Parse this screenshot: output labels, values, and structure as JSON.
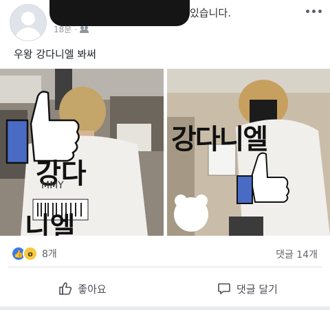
{
  "post": {
    "header_suffix": "있습니다.",
    "timestamp": "18분 ·",
    "caption": "우왕 강다니엘 봐써"
  },
  "photos": {
    "left": {
      "drawn_text_1": "강다",
      "drawn_text_2": "니엘",
      "shirt_text": "MMY"
    },
    "right": {
      "drawn_text": "강다니엘"
    }
  },
  "reactions": {
    "count": "8개",
    "comments": "댓글 14개"
  },
  "actions": {
    "like_label": "좋아요",
    "comment_label": "댓글 달기"
  },
  "colors": {
    "like_blue": "#3b7ae8",
    "wow_yellow": "#f7c940"
  },
  "icons": [
    "default-avatar-icon",
    "friends-icon",
    "more-icon",
    "thumbs-up-icon",
    "comment-icon",
    "like-reaction-icon",
    "wow-reaction-icon"
  ]
}
